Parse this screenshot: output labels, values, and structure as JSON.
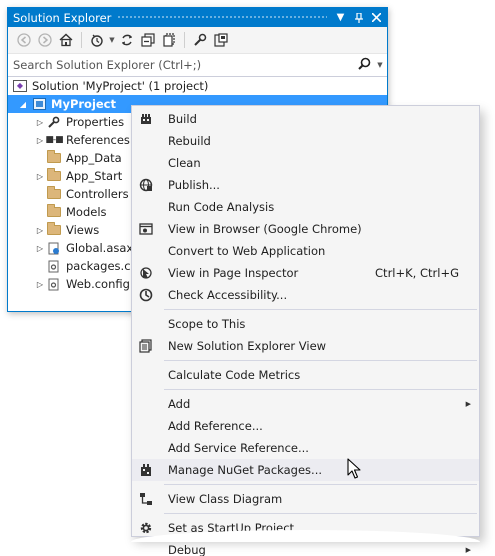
{
  "window": {
    "title": "Solution Explorer",
    "titlebar_color": "#007acc"
  },
  "toolbar": {
    "icons": [
      "back-icon",
      "forward-icon",
      "home-icon",
      "sync-icon",
      "refresh-icon",
      "collapse-all-icon",
      "show-all-files-icon",
      "properties-icon",
      "preview-icon"
    ]
  },
  "search": {
    "placeholder": "Search Solution Explorer (Ctrl+;)"
  },
  "tree": {
    "solution": "Solution 'MyProject' (1 project)",
    "project": "MyProject",
    "items": [
      {
        "label": "Properties"
      },
      {
        "label": "References"
      },
      {
        "label": "App_Data"
      },
      {
        "label": "App_Start"
      },
      {
        "label": "Controllers"
      },
      {
        "label": "Models"
      },
      {
        "label": "Views"
      },
      {
        "label": "Global.asax"
      },
      {
        "label": "packages.config"
      },
      {
        "label": "Web.config"
      }
    ],
    "selection_color": "#3399ff"
  },
  "context_menu": {
    "items": [
      {
        "label": "Build",
        "icon": "build-icon"
      },
      {
        "label": "Rebuild"
      },
      {
        "label": "Clean"
      },
      {
        "label": "Publish...",
        "icon": "publish-icon"
      },
      {
        "label": "Run Code Analysis"
      },
      {
        "label": "View in Browser (Google Chrome)",
        "icon": "browser-icon"
      },
      {
        "label": "Convert to Web Application"
      },
      {
        "label": "View in Page Inspector",
        "shortcut": "Ctrl+K, Ctrl+G",
        "icon": "page-inspector-icon"
      },
      {
        "label": "Check Accessibility...",
        "icon": "accessibility-icon"
      },
      {
        "label": "Scope to This"
      },
      {
        "label": "New Solution Explorer View",
        "icon": "new-view-icon"
      },
      {
        "label": "Calculate Code Metrics"
      },
      {
        "label": "Add"
      },
      {
        "label": "Add Reference..."
      },
      {
        "label": "Add Service Reference..."
      },
      {
        "label": "Manage NuGet Packages...",
        "icon": "nuget-icon"
      },
      {
        "label": "View Class Diagram",
        "icon": "class-diagram-icon"
      },
      {
        "label": "Set as StartUp Project",
        "icon": "gear-icon"
      },
      {
        "label": "Debug"
      }
    ],
    "highlight_color": "#ececf1"
  }
}
